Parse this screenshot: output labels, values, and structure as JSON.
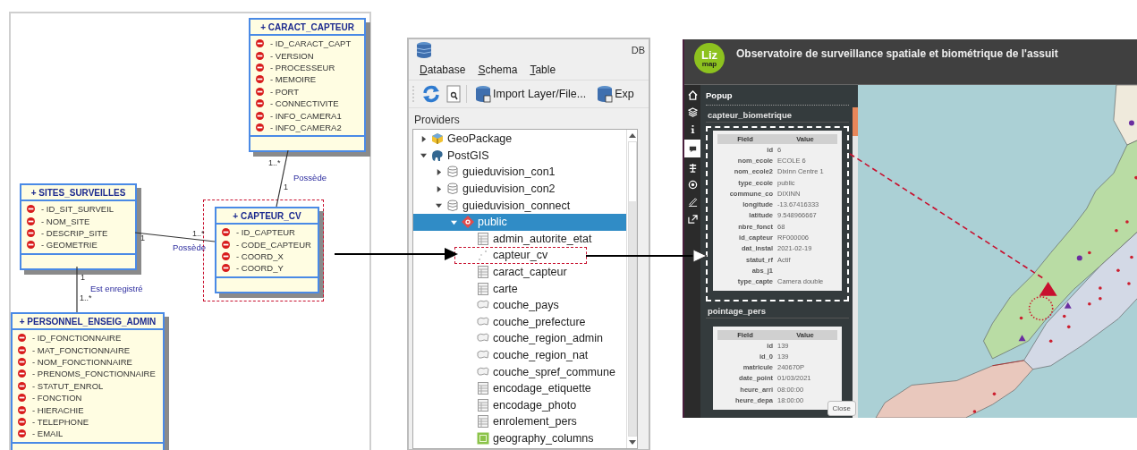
{
  "uml_diagram": {
    "classes": [
      {
        "name": "+ CARACT_CAPTEUR",
        "highlighted": false,
        "attributes": [
          "- ID_CARACT_CAPT",
          "- VERSION",
          "- PROCESSEUR",
          "- MEMOIRE",
          "- PORT",
          "- CONNECTIVITE",
          "- INFO_CAMERA1",
          "- INFO_CAMERA2"
        ]
      },
      {
        "name": "+ SITES_SURVEILLES",
        "highlighted": false,
        "attributes": [
          "- ID_SIT_SURVEIL",
          "- NOM_SITE",
          "- DESCRIP_SITE",
          "- GEOMETRIE"
        ]
      },
      {
        "name": "+ CAPTEUR_CV",
        "highlighted": true,
        "attributes": [
          "- ID_CAPTEUR",
          "- CODE_CAPTEUR",
          "- COORD_X",
          "- COORD_Y"
        ]
      },
      {
        "name": "+ PERSONNEL_ENSEIG_ADMIN",
        "highlighted": false,
        "attributes": [
          "- ID_FONCTIONNAIRE",
          "- MAT_FONCTIONNAIRE",
          "- NOM_FONCTIONNAIRE",
          "- PRENOMS_FONCTIONNAIRE",
          "- STATUT_ENROL",
          "- FONCTION",
          "- HIERACHIE",
          "- TELEPHONE",
          "- EMAIL"
        ]
      }
    ],
    "associations": [
      {
        "label": "Possède",
        "end_a": "1..*",
        "end_b": "1"
      },
      {
        "label": "Possède",
        "end_a": "1",
        "end_b": "1..*"
      },
      {
        "label": "Est enregistré",
        "end_a": "1",
        "end_b": "1..*"
      }
    ]
  },
  "db_manager": {
    "title": "DB",
    "menu": [
      "Database",
      "Schema",
      "Table"
    ],
    "import_button": "Import Layer/File...",
    "export_button": "Exp",
    "providers_label": "Providers",
    "tree": [
      {
        "label": "GeoPackage",
        "kind": "geopackage",
        "expanded": false,
        "selected": false
      },
      {
        "label": "PostGIS",
        "kind": "postgis",
        "expanded": true,
        "selected": false,
        "children": [
          {
            "label": "guieduvision_con1",
            "kind": "connection",
            "expanded": false,
            "selected": false
          },
          {
            "label": "guieduvision_con2",
            "kind": "connection",
            "expanded": false,
            "selected": false
          },
          {
            "label": "guieduvision_connect",
            "kind": "connection",
            "expanded": true,
            "selected": false,
            "children": [
              {
                "label": "public",
                "kind": "schema",
                "expanded": true,
                "selected": true,
                "children": [
                  {
                    "label": "admin_autorite_etat",
                    "kind": "table",
                    "selected": false,
                    "highlighted": false
                  },
                  {
                    "label": "capteur_cv",
                    "kind": "point",
                    "selected": false,
                    "highlighted": true
                  },
                  {
                    "label": "caract_capteur",
                    "kind": "table",
                    "selected": false,
                    "highlighted": false
                  },
                  {
                    "label": "carte",
                    "kind": "table",
                    "selected": false,
                    "highlighted": false
                  },
                  {
                    "label": "couche_pays",
                    "kind": "polygon",
                    "selected": false,
                    "highlighted": false
                  },
                  {
                    "label": "couche_prefecture",
                    "kind": "polygon",
                    "selected": false,
                    "highlighted": false
                  },
                  {
                    "label": "couche_region_admin",
                    "kind": "polygon",
                    "selected": false,
                    "highlighted": false
                  },
                  {
                    "label": "couche_region_nat",
                    "kind": "polygon",
                    "selected": false,
                    "highlighted": false
                  },
                  {
                    "label": "couche_spref_commune",
                    "kind": "polygon",
                    "selected": false,
                    "highlighted": false
                  },
                  {
                    "label": "encodage_etiquette",
                    "kind": "table",
                    "selected": false,
                    "highlighted": false
                  },
                  {
                    "label": "encodage_photo",
                    "kind": "table",
                    "selected": false,
                    "highlighted": false
                  },
                  {
                    "label": "enrolement_pers",
                    "kind": "table",
                    "selected": false,
                    "highlighted": false
                  },
                  {
                    "label": "geography_columns",
                    "kind": "view",
                    "selected": false,
                    "highlighted": false
                  }
                ]
              }
            ]
          }
        ]
      }
    ]
  },
  "lizmap": {
    "logo": [
      "Liz",
      "map"
    ],
    "title": "Observatoire de surveillance spatiale et biométrique de l'assuit",
    "tools": [
      {
        "kind": "home",
        "selected": false
      },
      {
        "kind": "layers",
        "selected": false
      },
      {
        "kind": "info",
        "selected": false
      },
      {
        "kind": "popup",
        "selected": true
      },
      {
        "kind": "legend",
        "selected": false
      },
      {
        "kind": "locate",
        "selected": false
      },
      {
        "kind": "draw",
        "selected": false
      },
      {
        "kind": "share",
        "selected": false
      }
    ],
    "popup": {
      "title": "Popup",
      "sections": [
        {
          "title": "capteur_biometrique",
          "highlighted": true,
          "columns": [
            "Field",
            "Value"
          ],
          "rows": [
            {
              "field": "id",
              "value": "6"
            },
            {
              "field": "nom_ecole",
              "value": "ECOLE 6"
            },
            {
              "field": "nom_ecole2",
              "value": "Dixinn Centre 1"
            },
            {
              "field": "type_ecole",
              "value": "public"
            },
            {
              "field": "commune_co",
              "value": "DIXINN"
            },
            {
              "field": "longitude",
              "value": "-13.67416333"
            },
            {
              "field": "latitude",
              "value": "9.548966667"
            },
            {
              "field": "nbre_fonct",
              "value": "68"
            },
            {
              "field": "id_capteur",
              "value": "RF000006"
            },
            {
              "field": "dat_instal",
              "value": "2021-02-19"
            },
            {
              "field": "statut_rf",
              "value": "Actif"
            },
            {
              "field": "abs_j1"
            },
            {
              "field": "type_capte",
              "value": "Camera double"
            }
          ]
        },
        {
          "title": "pointage_pers",
          "highlighted": false,
          "columns": [
            "Field",
            "Value"
          ],
          "rows": [
            {
              "field": "id",
              "value": "139"
            },
            {
              "field": "id_0",
              "value": "139"
            },
            {
              "field": "matricule",
              "value": "240670P"
            },
            {
              "field": "date_point",
              "value": "01/03/2021"
            },
            {
              "field": "heure_arri",
              "value": "08:00:00"
            },
            {
              "field": "heure_depa",
              "value": "18:00:00"
            }
          ]
        }
      ]
    },
    "close_button": "Close"
  }
}
